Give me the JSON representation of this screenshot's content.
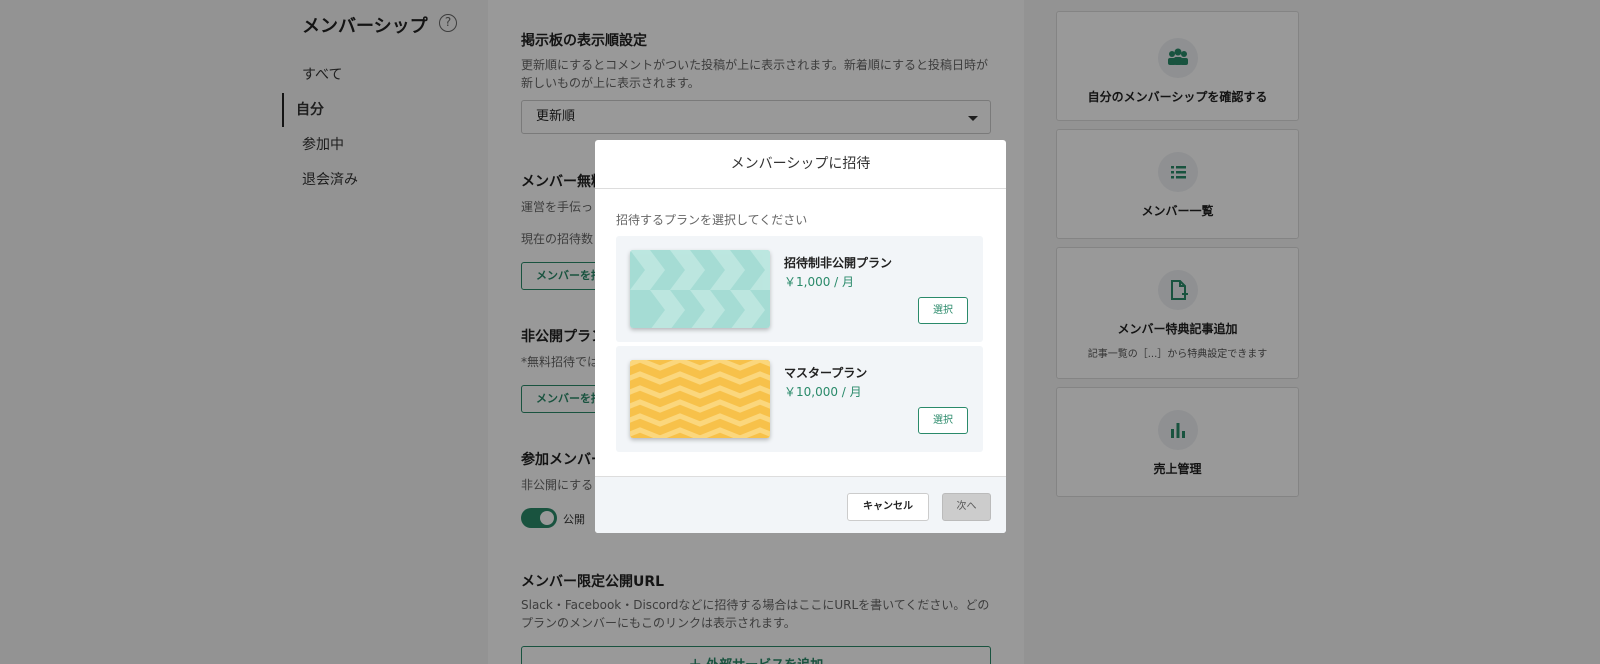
{
  "nav": {
    "title": "メンバーシップ",
    "items": [
      "すべて",
      "自分",
      "参加中",
      "退会済み"
    ]
  },
  "main": {
    "board_title": "掲示板の表示順設定",
    "board_desc": "更新順にするとコメントがついた投稿が上に表示されます。新着順にすると投稿日時が新しいものが上に表示されます。",
    "sort_value": "更新順",
    "free_title": "メンバー無料",
    "free_desc": "運営を手伝っ",
    "invite_count": "現在の招待数",
    "invite_btn_1": "メンバーを招",
    "private_title": "非公開プラン",
    "private_desc": "*無料招待では",
    "invite_btn_2": "メンバーを招",
    "join_title": "参加メンバー",
    "join_desc": "非公開にする",
    "toggle_label": "公開",
    "url_title": "メンバー限定公開URL",
    "url_desc": "Slack・Facebook・Discordなどに招待する場合はここにURLを書いてください。どのプランのメンバーにもこのリンクは表示されます。",
    "add_service_btn": "＋ 外部サービスを追加"
  },
  "cards": [
    {
      "title": "自分のメンバーシップを確認する",
      "sub": "",
      "icon": "people-icon"
    },
    {
      "title": "メンバー一覧",
      "sub": "",
      "icon": "list-icon"
    },
    {
      "title": "メンバー特典記事追加",
      "sub": "記事一覧の［...］から特典設定できます",
      "icon": "file-plus-icon"
    },
    {
      "title": "売上管理",
      "sub": "",
      "icon": "bar-chart-icon"
    }
  ],
  "modal": {
    "title": "メンバーシップに招待",
    "instruction": "招待するプランを選択してください",
    "plans": [
      {
        "name": "招待制非公開プラン",
        "price": "￥1,000 / 月",
        "select_label": "選択",
        "thumb_color": "#a5dcd4"
      },
      {
        "name": "マスタープラン",
        "price": "￥10,000 / 月",
        "select_label": "選択",
        "thumb_color": "#f7c14a"
      }
    ],
    "cancel_label": "キャンセル",
    "next_label": "次へ"
  },
  "colors": {
    "accent": "#2a8a6a"
  }
}
